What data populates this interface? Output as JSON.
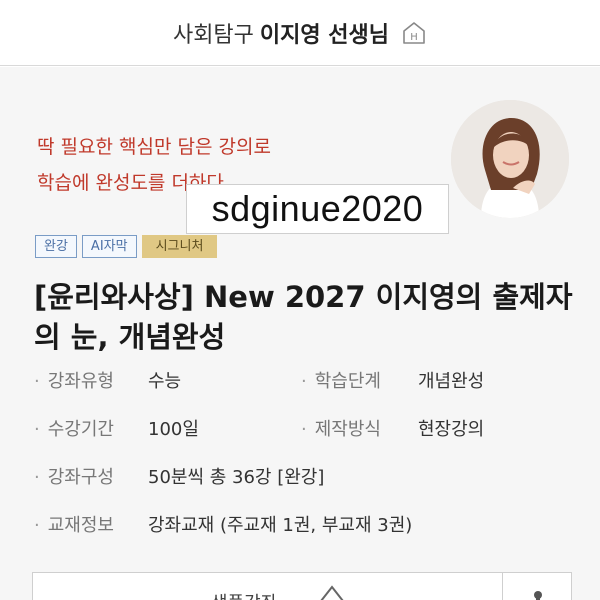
{
  "header": {
    "prefix": "사회탐구",
    "teacher": "이지영 선생님",
    "home_icon": "home-H-icon"
  },
  "promo": {
    "line1": "딱 필요한 핵심만 담은 강의로",
    "line2": "학습에 완성도를 더하다"
  },
  "watermark": "sdginue2020",
  "badges": [
    "완강",
    "AI자막",
    "시그니처"
  ],
  "course": {
    "title": "[윤리와사상] New 2027 이지영의 출제자의 눈, 개념완성"
  },
  "info": {
    "type_label": "강좌유형",
    "type_value": "수능",
    "stage_label": "학습단계",
    "stage_value": "개념완성",
    "period_label": "수강기간",
    "period_value": "100일",
    "method_label": "제작방식",
    "method_value": "현장강의",
    "composition_label": "강좌구성",
    "composition_value": "50분씩 총 36강 [완강]",
    "textbook_label": "교재정보",
    "textbook_value": "강좌교재 (주교재 1권, 부교재 3권)"
  },
  "bottom": {
    "label": "샘플강좌",
    "icon": "play-icon",
    "side_icon": "share-icon"
  },
  "colors": {
    "slogan": "#c0392b",
    "signature_badge": "#e0c884",
    "badge_border": "#7a9cc6"
  }
}
